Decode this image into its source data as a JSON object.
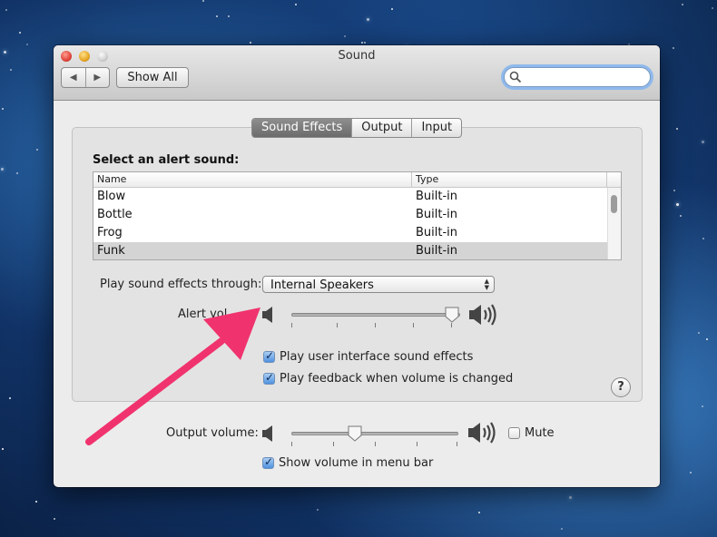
{
  "window": {
    "title": "Sound"
  },
  "toolbar": {
    "back_icon": "back-arrow-icon",
    "forward_icon": "forward-arrow-icon",
    "show_all_label": "Show All",
    "search_value": "",
    "search_placeholder": ""
  },
  "tabs": [
    {
      "label": "Sound Effects",
      "active": true
    },
    {
      "label": "Output",
      "active": false
    },
    {
      "label": "Input",
      "active": false
    }
  ],
  "alerts": {
    "section_label": "Select an alert sound:",
    "columns": [
      "Name",
      "Type"
    ],
    "rows": [
      {
        "name": "Blow",
        "type": "Built-in",
        "selected": false
      },
      {
        "name": "Bottle",
        "type": "Built-in",
        "selected": false
      },
      {
        "name": "Frog",
        "type": "Built-in",
        "selected": false
      },
      {
        "name": "Funk",
        "type": "Built-in",
        "selected": true
      }
    ]
  },
  "play_through": {
    "label": "Play sound effects through:",
    "value": "Internal Speakers"
  },
  "alert_volume": {
    "label": "Alert vol",
    "level": 0.95
  },
  "checkboxes": {
    "ui_sounds": {
      "label": "Play user interface sound effects",
      "checked": true
    },
    "feedback": {
      "label": "Play feedback when volume is changed",
      "checked": true
    }
  },
  "help": {
    "label": "?"
  },
  "output_volume": {
    "label": "Output volume:",
    "level": 0.38,
    "mute_label": "Mute",
    "muted": false
  },
  "menu_bar": {
    "label": "Show volume in menu bar",
    "checked": true
  },
  "colors": {
    "annotation_arrow": "#f0336e",
    "selection": "#d4d4d4",
    "search_focus": "#8fb9ec"
  }
}
